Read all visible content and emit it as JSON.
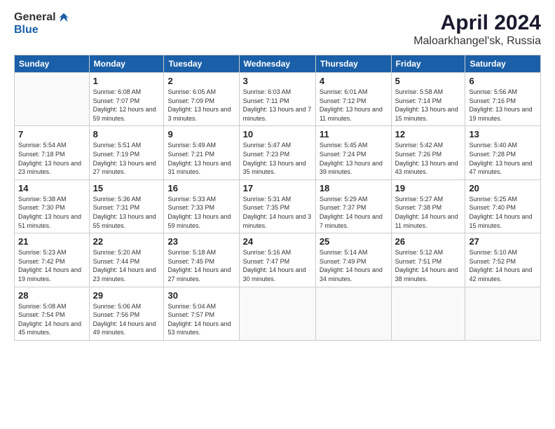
{
  "header": {
    "logo_general": "General",
    "logo_blue": "Blue",
    "title": "April 2024",
    "subtitle": "Maloarkhangel'sk, Russia"
  },
  "days_of_week": [
    "Sunday",
    "Monday",
    "Tuesday",
    "Wednesday",
    "Thursday",
    "Friday",
    "Saturday"
  ],
  "weeks": [
    [
      {
        "day": "",
        "sunrise": "",
        "sunset": "",
        "daylight": ""
      },
      {
        "day": "1",
        "sunrise": "Sunrise: 6:08 AM",
        "sunset": "Sunset: 7:07 PM",
        "daylight": "Daylight: 12 hours and 59 minutes."
      },
      {
        "day": "2",
        "sunrise": "Sunrise: 6:05 AM",
        "sunset": "Sunset: 7:09 PM",
        "daylight": "Daylight: 13 hours and 3 minutes."
      },
      {
        "day": "3",
        "sunrise": "Sunrise: 6:03 AM",
        "sunset": "Sunset: 7:11 PM",
        "daylight": "Daylight: 13 hours and 7 minutes."
      },
      {
        "day": "4",
        "sunrise": "Sunrise: 6:01 AM",
        "sunset": "Sunset: 7:12 PM",
        "daylight": "Daylight: 13 hours and 11 minutes."
      },
      {
        "day": "5",
        "sunrise": "Sunrise: 5:58 AM",
        "sunset": "Sunset: 7:14 PM",
        "daylight": "Daylight: 13 hours and 15 minutes."
      },
      {
        "day": "6",
        "sunrise": "Sunrise: 5:56 AM",
        "sunset": "Sunset: 7:16 PM",
        "daylight": "Daylight: 13 hours and 19 minutes."
      }
    ],
    [
      {
        "day": "7",
        "sunrise": "Sunrise: 5:54 AM",
        "sunset": "Sunset: 7:18 PM",
        "daylight": "Daylight: 13 hours and 23 minutes."
      },
      {
        "day": "8",
        "sunrise": "Sunrise: 5:51 AM",
        "sunset": "Sunset: 7:19 PM",
        "daylight": "Daylight: 13 hours and 27 minutes."
      },
      {
        "day": "9",
        "sunrise": "Sunrise: 5:49 AM",
        "sunset": "Sunset: 7:21 PM",
        "daylight": "Daylight: 13 hours and 31 minutes."
      },
      {
        "day": "10",
        "sunrise": "Sunrise: 5:47 AM",
        "sunset": "Sunset: 7:23 PM",
        "daylight": "Daylight: 13 hours and 35 minutes."
      },
      {
        "day": "11",
        "sunrise": "Sunrise: 5:45 AM",
        "sunset": "Sunset: 7:24 PM",
        "daylight": "Daylight: 13 hours and 39 minutes."
      },
      {
        "day": "12",
        "sunrise": "Sunrise: 5:42 AM",
        "sunset": "Sunset: 7:26 PM",
        "daylight": "Daylight: 13 hours and 43 minutes."
      },
      {
        "day": "13",
        "sunrise": "Sunrise: 5:40 AM",
        "sunset": "Sunset: 7:28 PM",
        "daylight": "Daylight: 13 hours and 47 minutes."
      }
    ],
    [
      {
        "day": "14",
        "sunrise": "Sunrise: 5:38 AM",
        "sunset": "Sunset: 7:30 PM",
        "daylight": "Daylight: 13 hours and 51 minutes."
      },
      {
        "day": "15",
        "sunrise": "Sunrise: 5:36 AM",
        "sunset": "Sunset: 7:31 PM",
        "daylight": "Daylight: 13 hours and 55 minutes."
      },
      {
        "day": "16",
        "sunrise": "Sunrise: 5:33 AM",
        "sunset": "Sunset: 7:33 PM",
        "daylight": "Daylight: 13 hours and 59 minutes."
      },
      {
        "day": "17",
        "sunrise": "Sunrise: 5:31 AM",
        "sunset": "Sunset: 7:35 PM",
        "daylight": "Daylight: 14 hours and 3 minutes."
      },
      {
        "day": "18",
        "sunrise": "Sunrise: 5:29 AM",
        "sunset": "Sunset: 7:37 PM",
        "daylight": "Daylight: 14 hours and 7 minutes."
      },
      {
        "day": "19",
        "sunrise": "Sunrise: 5:27 AM",
        "sunset": "Sunset: 7:38 PM",
        "daylight": "Daylight: 14 hours and 11 minutes."
      },
      {
        "day": "20",
        "sunrise": "Sunrise: 5:25 AM",
        "sunset": "Sunset: 7:40 PM",
        "daylight": "Daylight: 14 hours and 15 minutes."
      }
    ],
    [
      {
        "day": "21",
        "sunrise": "Sunrise: 5:23 AM",
        "sunset": "Sunset: 7:42 PM",
        "daylight": "Daylight: 14 hours and 19 minutes."
      },
      {
        "day": "22",
        "sunrise": "Sunrise: 5:20 AM",
        "sunset": "Sunset: 7:44 PM",
        "daylight": "Daylight: 14 hours and 23 minutes."
      },
      {
        "day": "23",
        "sunrise": "Sunrise: 5:18 AM",
        "sunset": "Sunset: 7:45 PM",
        "daylight": "Daylight: 14 hours and 27 minutes."
      },
      {
        "day": "24",
        "sunrise": "Sunrise: 5:16 AM",
        "sunset": "Sunset: 7:47 PM",
        "daylight": "Daylight: 14 hours and 30 minutes."
      },
      {
        "day": "25",
        "sunrise": "Sunrise: 5:14 AM",
        "sunset": "Sunset: 7:49 PM",
        "daylight": "Daylight: 14 hours and 34 minutes."
      },
      {
        "day": "26",
        "sunrise": "Sunrise: 5:12 AM",
        "sunset": "Sunset: 7:51 PM",
        "daylight": "Daylight: 14 hours and 38 minutes."
      },
      {
        "day": "27",
        "sunrise": "Sunrise: 5:10 AM",
        "sunset": "Sunset: 7:52 PM",
        "daylight": "Daylight: 14 hours and 42 minutes."
      }
    ],
    [
      {
        "day": "28",
        "sunrise": "Sunrise: 5:08 AM",
        "sunset": "Sunset: 7:54 PM",
        "daylight": "Daylight: 14 hours and 45 minutes."
      },
      {
        "day": "29",
        "sunrise": "Sunrise: 5:06 AM",
        "sunset": "Sunset: 7:56 PM",
        "daylight": "Daylight: 14 hours and 49 minutes."
      },
      {
        "day": "30",
        "sunrise": "Sunrise: 5:04 AM",
        "sunset": "Sunset: 7:57 PM",
        "daylight": "Daylight: 14 hours and 53 minutes."
      },
      {
        "day": "",
        "sunrise": "",
        "sunset": "",
        "daylight": ""
      },
      {
        "day": "",
        "sunrise": "",
        "sunset": "",
        "daylight": ""
      },
      {
        "day": "",
        "sunrise": "",
        "sunset": "",
        "daylight": ""
      },
      {
        "day": "",
        "sunrise": "",
        "sunset": "",
        "daylight": ""
      }
    ]
  ]
}
